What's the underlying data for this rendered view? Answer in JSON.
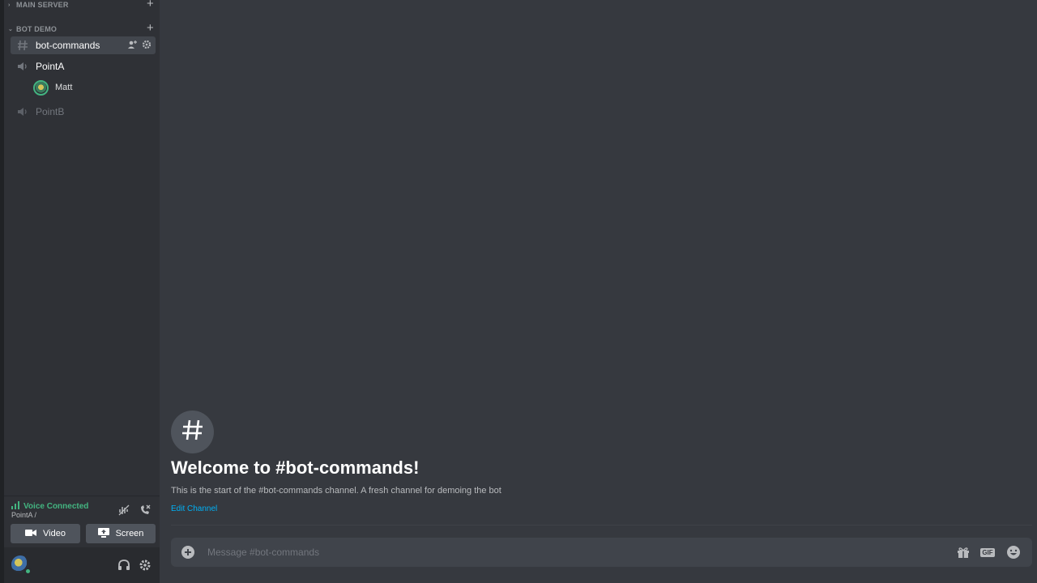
{
  "sidebar": {
    "categories": [
      {
        "label": "MAIN SERVER"
      },
      {
        "label": "BOT DEMO"
      }
    ],
    "channels": {
      "text_active": "bot-commands",
      "voice_a": "PointA",
      "voice_a_member": "Matt",
      "voice_b": "PointB"
    }
  },
  "voice_panel": {
    "status": "Voice Connected",
    "location": "PointA /",
    "video_label": "Video",
    "screen_label": "Screen"
  },
  "welcome": {
    "title": "Welcome to #bot-commands!",
    "subtitle": "This is the start of the #bot-commands channel. A fresh channel for demoing the bot",
    "edit_link": "Edit Channel"
  },
  "composer": {
    "placeholder": "Message #bot-commands",
    "gif_label": "GIF"
  },
  "colors": {
    "accent_green": "#43b581",
    "link_blue": "#00b0f4",
    "background": "#36393f",
    "sidebar": "#2f3136"
  }
}
